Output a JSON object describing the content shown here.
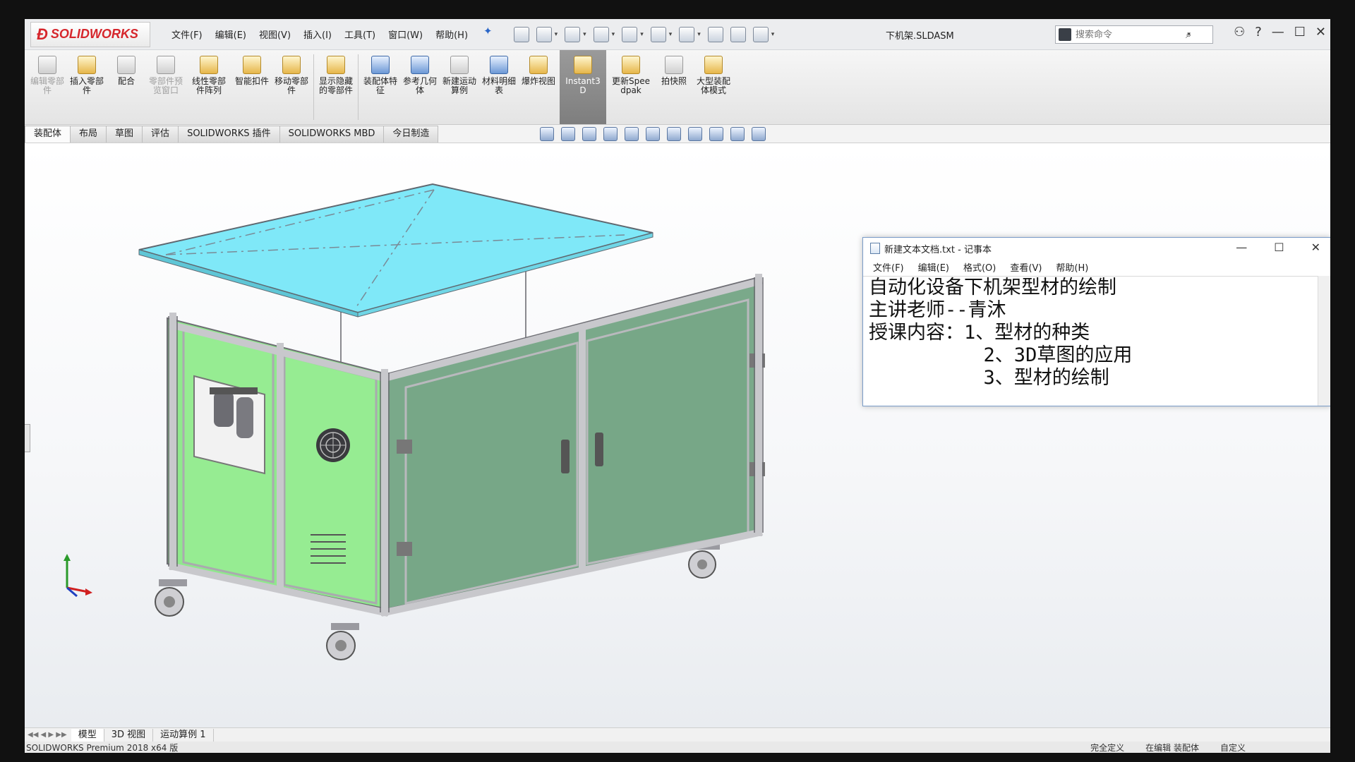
{
  "app": {
    "logo_text": "SOLIDWORKS",
    "logo_mark": "Ɖ",
    "document_title": "下机架.SLDASM"
  },
  "menu": [
    "文件(F)",
    "编辑(E)",
    "视图(V)",
    "插入(I)",
    "工具(T)",
    "窗口(W)",
    "帮助(H)"
  ],
  "search": {
    "placeholder": "搜索命令"
  },
  "window_controls": {
    "user": "⚇",
    "help": "?",
    "minimize": "—",
    "maximize": "☐",
    "close": "✕"
  },
  "commands": [
    {
      "label": "编辑零部件",
      "disabled": true
    },
    {
      "label": "插入零部件",
      "disabled": false
    },
    {
      "label": "配合",
      "disabled": false
    },
    {
      "label": "零部件预览窗口",
      "disabled": true
    },
    {
      "label": "线性零部件阵列",
      "disabled": false
    },
    {
      "label": "智能扣件",
      "disabled": false
    },
    {
      "label": "移动零部件",
      "disabled": false
    },
    {
      "label": "显示隐藏的零部件",
      "disabled": false
    },
    {
      "label": "装配体特征",
      "disabled": false
    },
    {
      "label": "参考几何体",
      "disabled": false
    },
    {
      "label": "新建运动算例",
      "disabled": false
    },
    {
      "label": "材料明细表",
      "disabled": false
    },
    {
      "label": "爆炸视图",
      "disabled": false
    },
    {
      "label": "Instant3D",
      "disabled": false,
      "active": true
    },
    {
      "label": "更新Speedpak",
      "disabled": false
    },
    {
      "label": "拍快照",
      "disabled": false
    },
    {
      "label": "大型装配体模式",
      "disabled": false
    }
  ],
  "tabs": [
    "装配体",
    "布局",
    "草图",
    "评估",
    "SOLIDWORKS 插件",
    "SOLIDWORKS MBD",
    "今日制造"
  ],
  "notepad": {
    "title": "新建文本文档.txt - 记事本",
    "menu": [
      "文件(F)",
      "编辑(E)",
      "格式(O)",
      "查看(V)",
      "帮助(H)"
    ],
    "lines": [
      "自动化设备下机架型材的绘制",
      "主讲老师--青沐",
      "授课内容：1、型材的种类",
      "          2、3D草图的应用",
      "          3、型材的绘制"
    ]
  },
  "bottom_tabs": [
    "模型",
    "3D 视图",
    "运动算例 1"
  ],
  "status": {
    "left": "SOLIDWORKS Premium 2018 x64 版",
    "right": [
      "完全定义",
      "在编辑 装配体",
      "自定义"
    ]
  },
  "colors": {
    "glass_top": "#7fe8f8",
    "side_panel": "#8fe88c",
    "front_panel": "#7aa98a",
    "frame": "#c8c8cc",
    "accent": "#d6262c"
  }
}
